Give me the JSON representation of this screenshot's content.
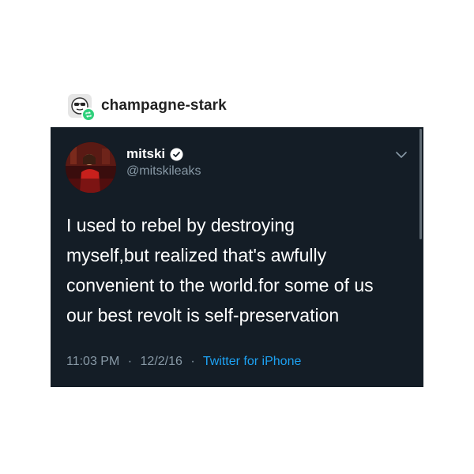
{
  "reblog": {
    "username": "champagne-stark",
    "avatar_icon": "sunglasses-face-icon",
    "badge_icon": "reblog-icon",
    "badge_color": "#2fd07b"
  },
  "tweet": {
    "author_name": "mitski",
    "author_handle": "@mitskileaks",
    "verified_icon": "verified-badge-icon",
    "menu_icon": "chevron-down-icon",
    "text_lines": [
      "I used to rebel by destroying",
      "myself,but realized that's awfully",
      "convenient to the world.for some of us",
      "our best revolt is self-preservation"
    ],
    "time": "11:03 PM",
    "date": "12/2/16",
    "separator": "·",
    "source": "Twitter for iPhone",
    "background_color": "#141d26",
    "link_color": "#1da1f2",
    "secondary_text_color": "#8899a6"
  }
}
